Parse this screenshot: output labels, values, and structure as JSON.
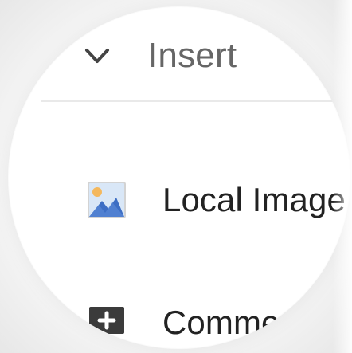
{
  "menu": {
    "header": {
      "title": "Insert",
      "toggle_icon": "chevron-down-icon"
    },
    "items": [
      {
        "label": "Local Image...",
        "icon": "image-icon"
      },
      {
        "label": "Comment",
        "icon": "comment-add-icon"
      }
    ]
  },
  "colors": {
    "header_text": "#666666",
    "item_text": "#222222",
    "divider": "#e9e9e9",
    "image_sky": "#d9e7f7",
    "image_sun": "#f4b85d",
    "image_mountain": "#3d6ec4",
    "comment_icon": "#3b3b3b"
  }
}
